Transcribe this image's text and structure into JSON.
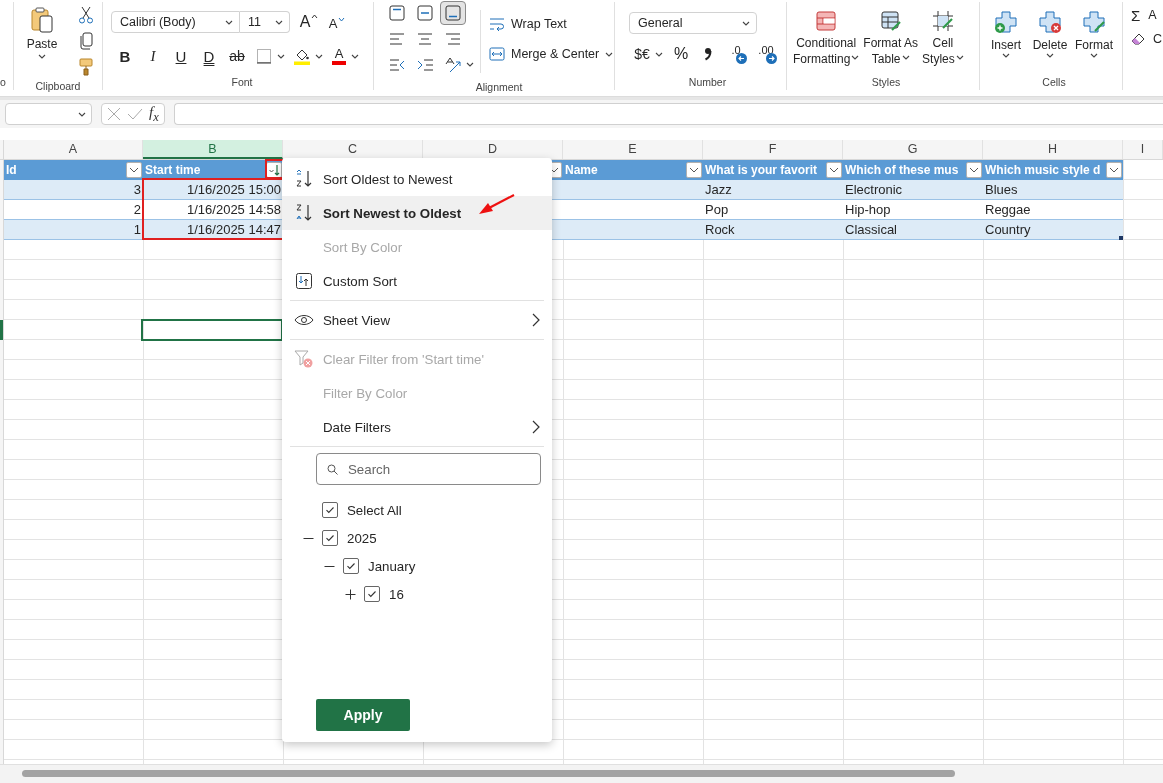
{
  "ribbon": {
    "undo": {
      "label": "o"
    },
    "clipboard": {
      "label": "Clipboard",
      "paste": "Paste"
    },
    "font": {
      "label": "Font",
      "font_name": "Calibri (Body)",
      "font_size": "11",
      "grow": "A",
      "shrink": "A",
      "font_color": "A",
      "styles": [
        {
          "kind": "bold",
          "text": "B"
        },
        {
          "kind": "italic",
          "text": "I"
        },
        {
          "kind": "underline",
          "text": "U"
        },
        {
          "kind": "double_underline",
          "text": "D"
        },
        {
          "kind": "strikethrough",
          "text": "ab"
        }
      ]
    },
    "alignment": {
      "label": "Alignment",
      "wrap_text": "Wrap Text",
      "merge_center": "Merge & Center",
      "align_buttons": [
        {
          "kind": "top",
          "selected": false
        },
        {
          "kind": "middle",
          "selected": false
        },
        {
          "kind": "bottom",
          "selected": true
        },
        {
          "kind": "left",
          "selected": false
        },
        {
          "kind": "center",
          "selected": false
        },
        {
          "kind": "right",
          "selected": false
        },
        {
          "kind": "decrease_indent",
          "selected": false
        },
        {
          "kind": "increase_indent",
          "selected": false
        },
        {
          "kind": "orientation",
          "selected": false
        }
      ]
    },
    "number": {
      "label": "Number",
      "format": "General",
      "currency": "$€",
      "percent": "%",
      "decimals": [
        ".0",
        ".00"
      ]
    },
    "styles": {
      "label": "Styles",
      "buttons": [
        {
          "kind": "conditional",
          "lines": [
            "Conditional",
            "Formatting"
          ]
        },
        {
          "kind": "table",
          "lines": [
            "Format As",
            "Table"
          ]
        },
        {
          "kind": "cell_styles",
          "lines": [
            "Cell",
            "Styles"
          ]
        }
      ]
    },
    "cells": {
      "label": "Cells",
      "buttons": [
        {
          "kind": "insert",
          "label": "Insert"
        },
        {
          "kind": "delete",
          "label": "Delete"
        },
        {
          "kind": "format",
          "label": "Format"
        }
      ]
    },
    "editing": {
      "autosum_symbol": "Σ",
      "autosum": "A",
      "clear": "C"
    }
  },
  "formula_bar": {
    "function_button": "f$_{x}$"
  },
  "sheet": {
    "columns": [
      {
        "letter": "A",
        "selected": false
      },
      {
        "letter": "B",
        "selected": true
      },
      {
        "letter": "C",
        "selected": false
      },
      {
        "letter": "D",
        "selected": false
      },
      {
        "letter": "E",
        "selected": false
      },
      {
        "letter": "F",
        "selected": false
      },
      {
        "letter": "G",
        "selected": false
      },
      {
        "letter": "H",
        "selected": false
      },
      {
        "letter": "I",
        "selected": false
      }
    ],
    "headers": [
      {
        "label": "Id",
        "sorted": false
      },
      {
        "label": "Start time",
        "sorted": true
      },
      {
        "sorted": false
      },
      {
        "label": "Name",
        "sorted": false
      },
      {
        "label": "What is your favorit",
        "sorted": false
      },
      {
        "label": "Which of these mus",
        "sorted": false
      },
      {
        "label": "Which music style d",
        "sorted": false
      }
    ],
    "rows": [
      {
        "id": "3",
        "start_time": "1/16/2025 15:00",
        "column_f": "Jazz",
        "column_g": "Electronic",
        "column_h": "Blues"
      },
      {
        "id": "2",
        "start_time": "1/16/2025 14:58",
        "column_f": "Pop",
        "column_g": "Hip-hop",
        "column_h": "Reggae"
      },
      {
        "id": "1",
        "start_time": "1/16/2025 14:47",
        "column_f": "Rock",
        "column_g": "Classical",
        "column_h": "Country"
      }
    ]
  },
  "menu": {
    "items": [
      {
        "kind": "sort_ascending",
        "label": "Sort Oldest to Newest",
        "disabled": false,
        "highlighted": false,
        "submenu": false
      },
      {
        "kind": "sort_descending",
        "label": "Sort Newest to Oldest",
        "disabled": false,
        "highlighted": true,
        "submenu": false
      },
      {
        "kind": "plain",
        "label": "Sort By Color",
        "disabled": true,
        "highlighted": false,
        "submenu": false
      },
      {
        "kind": "custom_sort",
        "label": "Custom Sort",
        "disabled": false,
        "highlighted": false,
        "submenu": false
      },
      {
        "kind": "separator"
      },
      {
        "kind": "view",
        "label": "Sheet View",
        "disabled": false,
        "highlighted": false,
        "submenu": true
      },
      {
        "kind": "separator"
      },
      {
        "kind": "clear_filter",
        "label": "Clear Filter from 'Start time'",
        "disabled": true,
        "highlighted": false,
        "submenu": false
      },
      {
        "kind": "plain",
        "label": "Filter By Color",
        "disabled": true,
        "highlighted": false,
        "submenu": false
      },
      {
        "kind": "plain",
        "label": "Date Filters",
        "disabled": false,
        "highlighted": false,
        "submenu": true
      },
      {
        "kind": "separator"
      }
    ],
    "search": {
      "placeholder": "Search"
    },
    "select_all": {
      "label": "Select All",
      "checked": true
    },
    "tree": [
      {
        "label": "2025",
        "checked": true,
        "expanded": true,
        "children": [
          {
            "label": "January",
            "checked": true,
            "expanded": true,
            "children": [
              {
                "label": "16",
                "checked": true,
                "expanded": false
              }
            ]
          }
        ]
      }
    ],
    "apply": "Apply"
  },
  "annotations": {
    "highlight_filter_button": true,
    "highlight_start_times": true,
    "arrow": true
  }
}
